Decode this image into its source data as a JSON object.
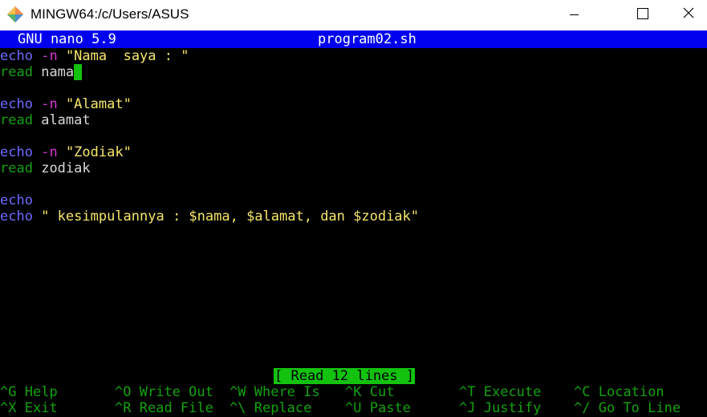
{
  "window": {
    "title": "MINGW64:/c/Users/ASUS",
    "icons": {
      "app": "git-diamond-icon",
      "minimize": "minimize-icon",
      "maximize": "maximize-icon",
      "close": "close-icon"
    }
  },
  "nano": {
    "version_label": "GNU nano 5.9",
    "filename": "program02.sh",
    "status_message": "[ Read 12 lines ]"
  },
  "code": {
    "l1": {
      "kw": "echo",
      "opt": "-n",
      "str": "\"Nama  saya : \""
    },
    "l2": {
      "kw": "read",
      "arg": "nama"
    },
    "l4": {
      "kw": "echo",
      "opt": "-n",
      "str": "\"Alamat\""
    },
    "l5": {
      "kw": "read",
      "arg": "alamat"
    },
    "l7": {
      "kw": "echo",
      "opt": "-n",
      "str": "\"Zodiak\""
    },
    "l8": {
      "kw": "read",
      "arg": "zodiak"
    },
    "l10": {
      "kw": "echo"
    },
    "l11": {
      "kw": "echo",
      "str": "\" kesimpulannya : $nama, $alamat, dan $zodiak\""
    }
  },
  "shortcuts": [
    {
      "key": "^G",
      "label": "Help"
    },
    {
      "key": "^O",
      "label": "Write Out"
    },
    {
      "key": "^W",
      "label": "Where Is"
    },
    {
      "key": "^K",
      "label": "Cut"
    },
    {
      "key": "^T",
      "label": "Execute"
    },
    {
      "key": "^C",
      "label": "Location"
    },
    {
      "key": "^X",
      "label": "Exit"
    },
    {
      "key": "^R",
      "label": "Read File"
    },
    {
      "key": "^\\",
      "label": "Replace"
    },
    {
      "key": "^U",
      "label": "Paste"
    },
    {
      "key": "^J",
      "label": "Justify"
    },
    {
      "key": "^/",
      "label": "Go To Line"
    }
  ],
  "colors": {
    "header_bg": "#0000ee",
    "keyword_echo": "#6b6bff",
    "keyword_read": "#13a10e",
    "option": "#d633d6",
    "string": "#f5e66b",
    "cursor": "#13c20e"
  }
}
